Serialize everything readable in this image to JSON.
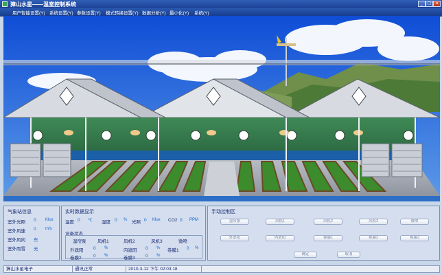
{
  "window": {
    "title": "獐山水星——温室控制系统",
    "minimize_glyph": "_",
    "maximize_glyph": "□",
    "close_glyph": "×"
  },
  "menu": [
    "用户智能设置(Y)",
    "系统设置(Y)",
    "参数设置(Y)",
    "模式转换设置(Y)",
    "数据分析(Y)",
    "最小化(Y)",
    "系统(Y)"
  ],
  "weather": {
    "title": "气象站信息",
    "items": [
      {
        "label": "室外光照",
        "value": "0",
        "unit": "Klux"
      },
      {
        "label": "室外风速",
        "value": "0",
        "unit": "m/s"
      },
      {
        "label": "室外风向",
        "value": "东",
        "unit": ""
      },
      {
        "label": "室外雨雪",
        "value": "无",
        "unit": ""
      }
    ]
  },
  "realtime": {
    "title": "实时数据显示",
    "readings": [
      {
        "label": "温度",
        "value": "0",
        "unit": "℃"
      },
      {
        "label": "湿度",
        "value": "0",
        "unit": "%"
      },
      {
        "label": "光照",
        "value": "0",
        "unit": "Klux"
      },
      {
        "label": "CO2",
        "value": "0",
        "unit": "PPM"
      }
    ],
    "device_title": "设备状态",
    "headers": [
      "湿帘泵",
      "风机1",
      "风机2",
      "风机3",
      "微喷"
    ],
    "rows": [
      [
        {
          "label": "外遮阳",
          "value": "0",
          "unit": "%"
        },
        {
          "label": "内遮阳",
          "value": "0",
          "unit": "%"
        },
        {
          "label": "卷膜1",
          "value": "0",
          "unit": "%"
        }
      ],
      [
        {
          "label": "卷膜2",
          "value": "0",
          "unit": "%"
        },
        {
          "label": "卷膜3",
          "value": "0",
          "unit": "%"
        }
      ]
    ]
  },
  "manual": {
    "title": "手动控制区",
    "row1": [
      "湿帘泵",
      "风机1",
      "风机2",
      "风机3",
      "微喷"
    ],
    "row2": [
      "外遮阳",
      "内遮阳",
      "卷膜1",
      "卷膜2",
      "卷膜3"
    ],
    "confirm": "确定",
    "cancel": "取消"
  },
  "status": {
    "company": "獐山水星电子",
    "comm": "通讯正常",
    "datetime": "2010-3-12 下午 02:03:18"
  },
  "colors": {
    "title_bar": "#1d4196",
    "panel_bg": "#d4deee",
    "value_blue": "#1760c9",
    "label_navy": "#1b2c75"
  }
}
